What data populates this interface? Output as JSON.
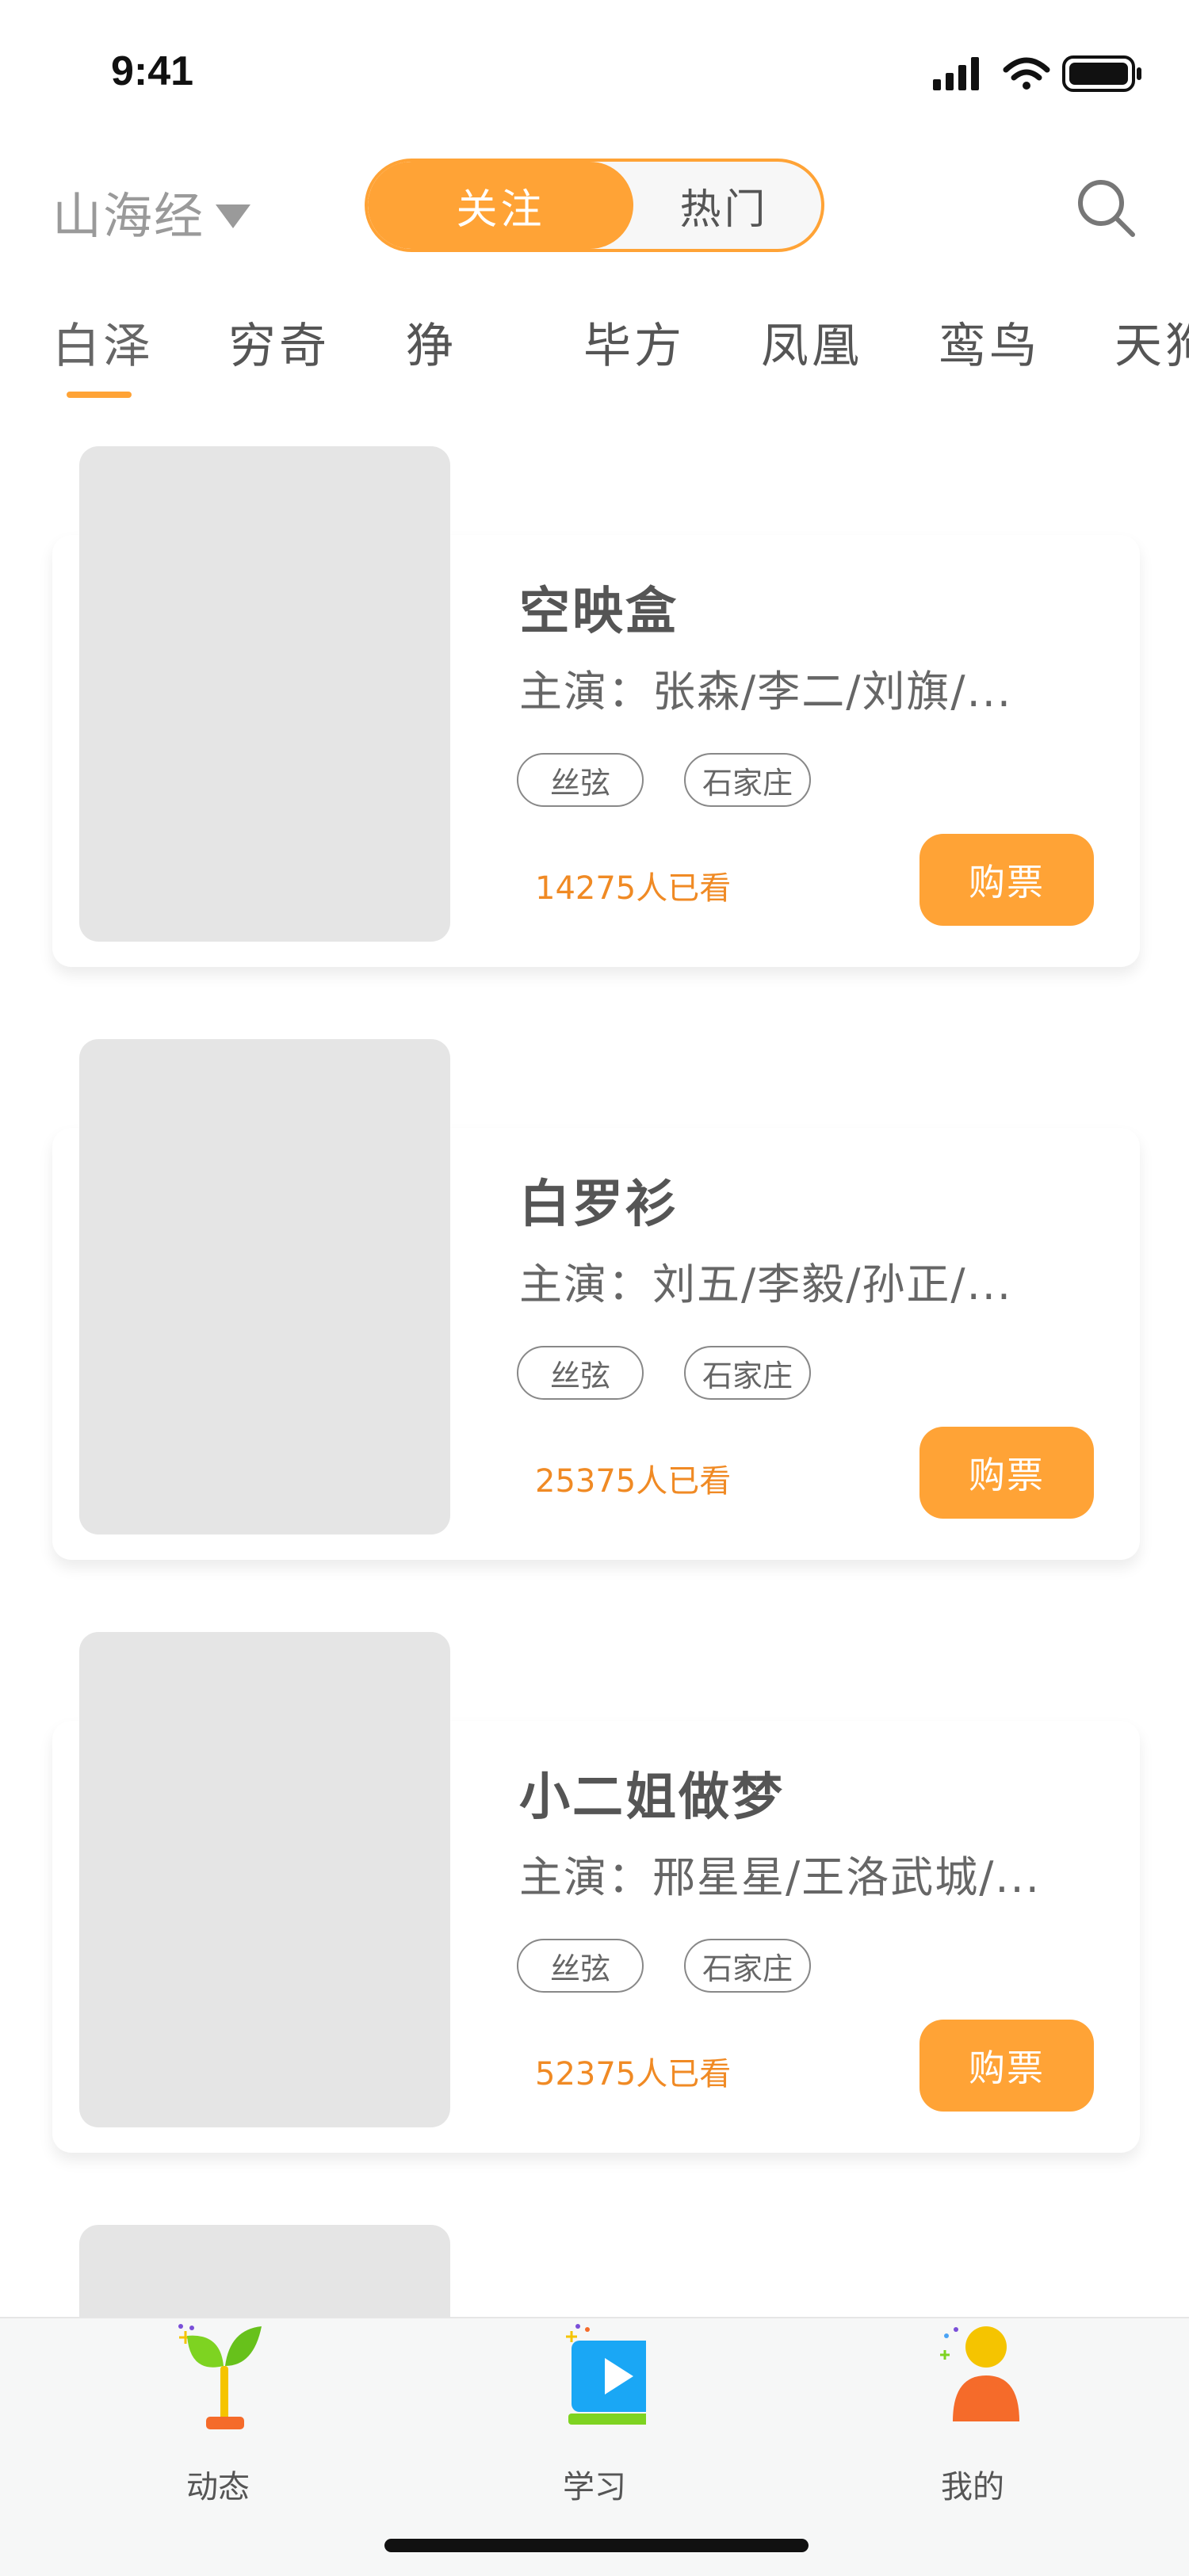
{
  "status_bar": {
    "time": "9:41"
  },
  "header": {
    "location": "山海经",
    "toggle": {
      "active": "关注",
      "inactive": "热门"
    }
  },
  "categories": [
    "白泽",
    "穷奇",
    "狰",
    "毕方",
    "凤凰",
    "鸾鸟",
    "天狗"
  ],
  "shows": [
    {
      "title": "空映盒",
      "cast": "主演：张森/李二/刘旗/...",
      "tags": [
        "丝弦",
        "石家庄"
      ],
      "views": "14275人已看",
      "buy_label": "购票"
    },
    {
      "title": "白罗衫",
      "cast": "主演：刘五/李毅/孙正/...",
      "tags": [
        "丝弦",
        "石家庄"
      ],
      "views": "25375人已看",
      "buy_label": "购票"
    },
    {
      "title": "小二姐做梦",
      "cast": "主演：邢星星/王洛武城/...",
      "tags": [
        "丝弦",
        "石家庄"
      ],
      "views": "52375人已看",
      "buy_label": "购票"
    }
  ],
  "bottom_nav": [
    {
      "label": "动态",
      "icon": "sprout-icon"
    },
    {
      "label": "学习",
      "icon": "play-video-icon"
    },
    {
      "label": "我的",
      "icon": "user-profile-icon"
    }
  ],
  "colors": {
    "accent": "#ffa336",
    "views_text": "#f08a24",
    "poster_placeholder": "#e5e5e5"
  }
}
